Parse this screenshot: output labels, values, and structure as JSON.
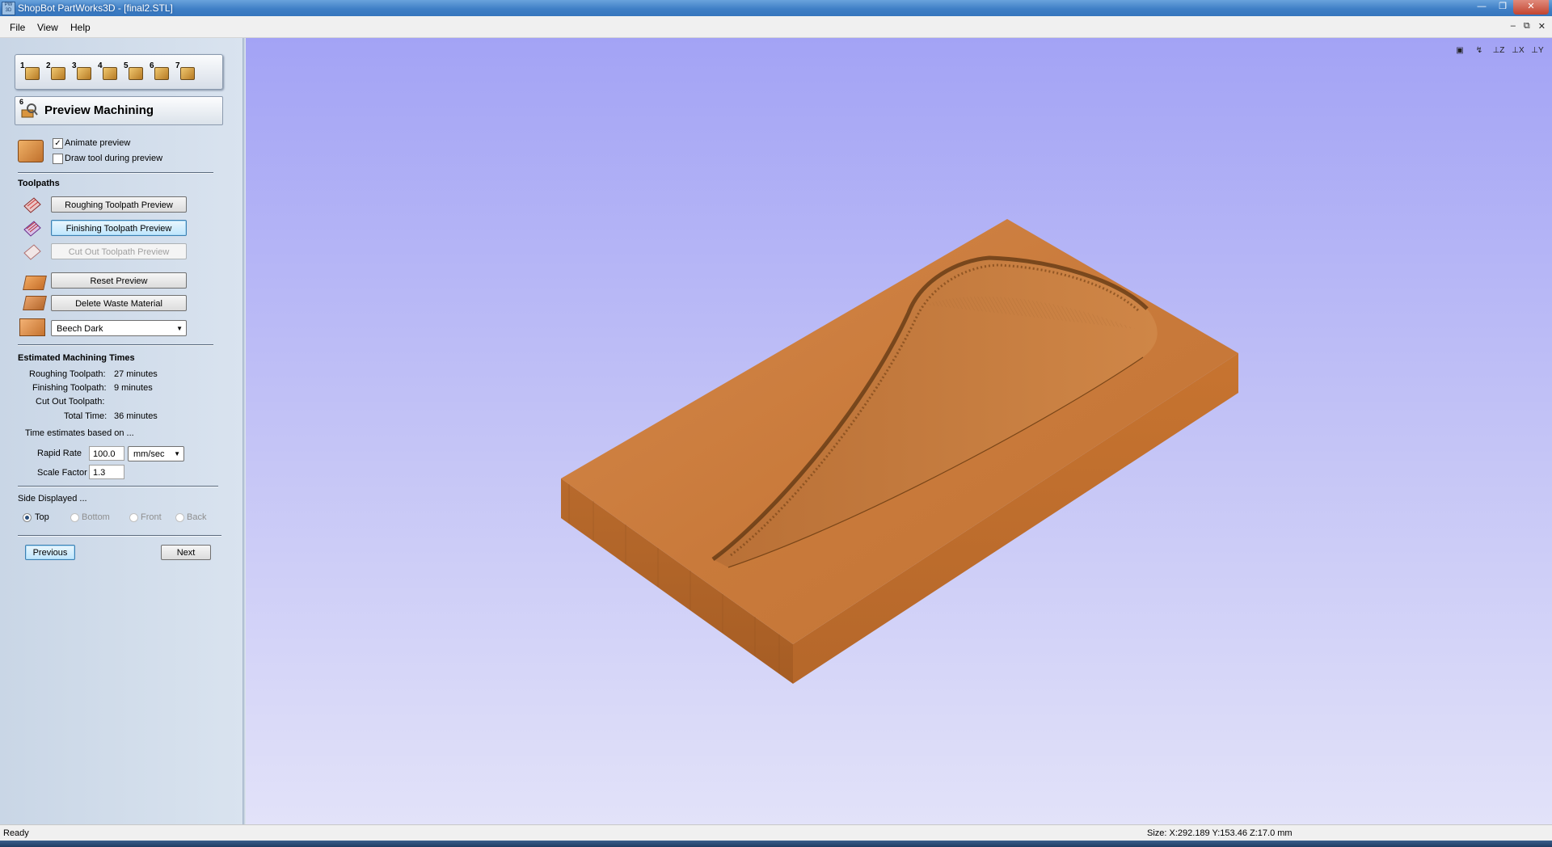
{
  "window": {
    "title": "ShopBot PartWorks3D - [final2.STL]",
    "app_icon": "PW 3D"
  },
  "menu": [
    "File",
    "View",
    "Help"
  ],
  "steps": [
    "1",
    "2",
    "3",
    "4",
    "5",
    "6",
    "7"
  ],
  "page": {
    "step": "6",
    "title": "Preview Machining"
  },
  "options": {
    "animate_preview": "Animate preview",
    "animate_checked": true,
    "draw_tool": "Draw tool during preview",
    "draw_checked": false
  },
  "toolpaths": {
    "header": "Toolpaths",
    "roughing": "Roughing Toolpath Preview",
    "finishing": "Finishing Toolpath Preview",
    "cutout": "Cut Out Toolpath Preview",
    "reset": "Reset Preview",
    "delete_waste": "Delete Waste Material",
    "material": "Beech Dark"
  },
  "times": {
    "header": "Estimated Machining Times",
    "roughing_label": "Roughing Toolpath:",
    "roughing_value": "27 minutes",
    "finishing_label": "Finishing Toolpath:",
    "finishing_value": "9 minutes",
    "cutout_label": "Cut Out Toolpath:",
    "cutout_value": "",
    "total_label": "Total Time:",
    "total_value": "36 minutes",
    "based_on": "Time estimates based on ...",
    "rapid_label": "Rapid Rate",
    "rapid_value": "100.0",
    "rapid_unit": "mm/sec",
    "scale_label": "Scale Factor",
    "scale_value": "1.3"
  },
  "side": {
    "header": "Side Displayed ...",
    "top": "Top",
    "bottom": "Bottom",
    "front": "Front",
    "back": "Back",
    "selected": "Top"
  },
  "nav": {
    "previous": "Previous",
    "next": "Next"
  },
  "status": {
    "left": "Ready",
    "right": "Size: X:292.189 Y:153.46 Z:17.0 mm"
  },
  "view_tools": [
    "zoom-extents-icon",
    "iso-view-icon",
    "z-view-icon",
    "x-view-icon",
    "y-view-icon"
  ],
  "colors": {
    "wood": "#c8793a",
    "background_top": "#a3a3f5",
    "background_bottom": "#e2e2f9"
  }
}
